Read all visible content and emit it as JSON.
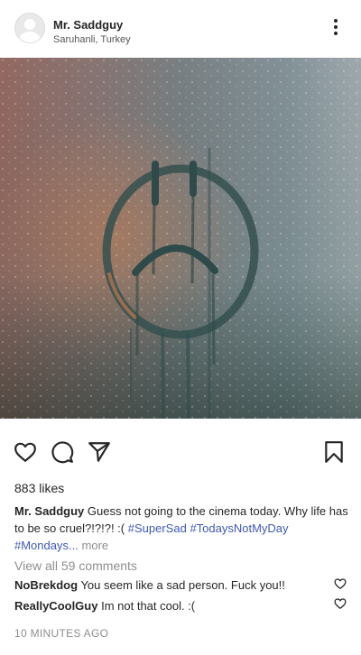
{
  "post": {
    "username": "Mr. Saddguy",
    "location": "Saruhanli, Turkey",
    "likes": "883 likes",
    "caption": {
      "username": "Mr. Saddguy",
      "text": "Guess not going to the cinema today. Why life has to be so cruel?!?!?! :(",
      "hashtags": [
        "#SuperSad",
        "#TodaysNotMyDay",
        "#Mondays..."
      ],
      "more_label": "more"
    },
    "view_all_comments": "View all 59 comments",
    "comments": [
      {
        "username": "NoBrekdog",
        "text": "You seem like a sad person. Fuck you!!"
      },
      {
        "username": "ReallyCoolGuy",
        "text": "Im not that cool. :("
      }
    ],
    "timestamp": "10 MINUTES AGO"
  },
  "icons": {
    "avatar": "default-user-icon",
    "more": "more-vertical-icon",
    "like": "heart-icon",
    "comment": "comment-icon",
    "share": "paper-plane-icon",
    "save": "bookmark-icon",
    "comment_like": "heart-icon"
  },
  "colors": {
    "text": "#262626",
    "muted": "#8e8e8e",
    "hashtag": "#3f59b3"
  }
}
